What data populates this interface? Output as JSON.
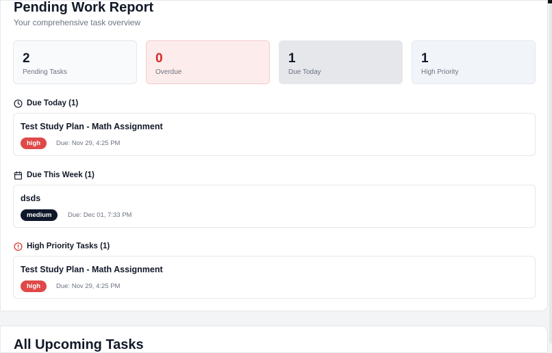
{
  "report": {
    "title": "Pending Work Report",
    "subtitle": "Your comprehensive task overview"
  },
  "stats": [
    {
      "value": "2",
      "label": "Pending Tasks",
      "bg": "#f8fafc",
      "border": "#e5e7eb",
      "color": "#111827"
    },
    {
      "value": "0",
      "label": "Overdue",
      "bg": "#fdecec",
      "border": "#f6caca",
      "color": "#dc2626"
    },
    {
      "value": "1",
      "label": "Due Today",
      "bg": "#e5e7eb",
      "border": "#e5e7eb",
      "color": "#111827"
    },
    {
      "value": "1",
      "label": "High Priority",
      "bg": "#f1f5f9",
      "border": "#e5e7eb",
      "color": "#111827"
    }
  ],
  "sections": {
    "due_today": {
      "heading": "Due Today (1)",
      "icon": "clock-icon",
      "task": {
        "title": "Test Study Plan - Math Assignment",
        "priority": "high",
        "due": "Due: Nov 29, 4:25 PM"
      }
    },
    "due_week": {
      "heading": "Due This Week (1)",
      "icon": "calendar-icon",
      "task": {
        "title": "dsds",
        "priority": "medium",
        "due": "Due: Dec 01, 7:33 PM"
      }
    },
    "high_priority": {
      "heading": "High Priority Tasks (1)",
      "icon": "alert-circle-icon",
      "task": {
        "title": "Test Study Plan - Math Assignment",
        "priority": "high",
        "due": "Due: Nov 29, 4:25 PM"
      }
    }
  },
  "upcoming": {
    "heading": "All Upcoming Tasks"
  },
  "colors": {
    "high": "#e04848",
    "medium": "#0f172a",
    "alert": "#dc2626"
  }
}
